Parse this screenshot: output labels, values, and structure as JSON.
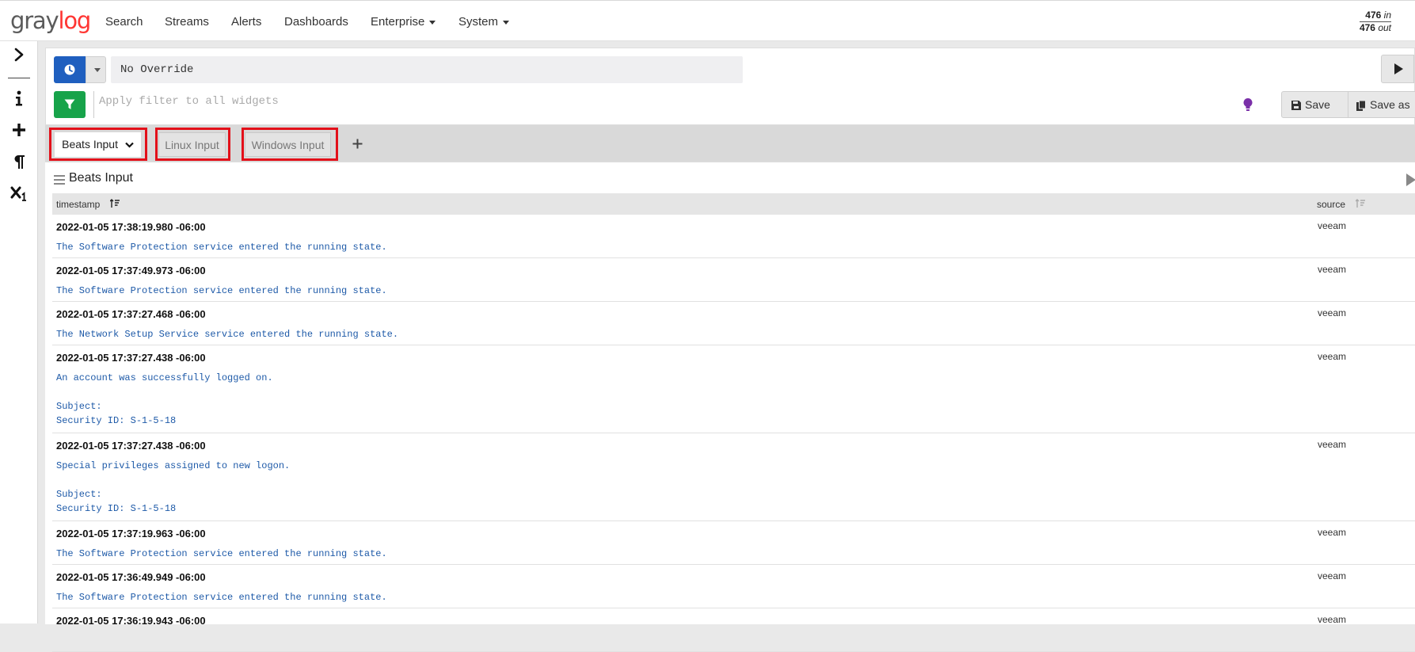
{
  "app": {
    "logo_main": "gray",
    "logo_accent": "log"
  },
  "nav": {
    "items": [
      {
        "label": "Search"
      },
      {
        "label": "Streams"
      },
      {
        "label": "Alerts"
      },
      {
        "label": "Dashboards"
      },
      {
        "label": "Enterprise",
        "dropdown": true
      },
      {
        "label": "System",
        "dropdown": true
      }
    ],
    "throughput": {
      "in_value": "476",
      "in_label": "in",
      "out_value": "476",
      "out_label": "out"
    }
  },
  "sidebar": {
    "icons": [
      "chevron-right-icon",
      "info-icon",
      "plus-icon",
      "paragraph-icon",
      "subscript-icon"
    ]
  },
  "query_bar": {
    "time_override": "No Override",
    "filter_placeholder": "Apply filter to all widgets",
    "save_label": "Save",
    "save_as_label": "Save as"
  },
  "tabs": {
    "items": [
      {
        "label": "Beats Input",
        "active": true
      },
      {
        "label": "Linux Input",
        "active": false
      },
      {
        "label": "Windows Input",
        "active": false
      }
    ],
    "highlight_color": "#e3101a"
  },
  "widget": {
    "title": "Beats Input",
    "columns": {
      "timestamp": "timestamp",
      "source": "source"
    },
    "rows": [
      {
        "timestamp": "2022-01-05 17:38:19.980 -06:00",
        "source": "veeam",
        "message": "The Software Protection service entered the running state."
      },
      {
        "timestamp": "2022-01-05 17:37:49.973 -06:00",
        "source": "veeam",
        "message": "The Software Protection service entered the running state."
      },
      {
        "timestamp": "2022-01-05 17:37:27.468 -06:00",
        "source": "veeam",
        "message": "The Network Setup Service service entered the running state."
      },
      {
        "timestamp": "2022-01-05 17:37:27.438 -06:00",
        "source": "veeam",
        "message": "An account was successfully logged on.\n\nSubject:\nSecurity ID: S-1-5-18"
      },
      {
        "timestamp": "2022-01-05 17:37:27.438 -06:00",
        "source": "veeam",
        "message": "Special privileges assigned to new logon.\n\nSubject:\nSecurity ID: S-1-5-18"
      },
      {
        "timestamp": "2022-01-05 17:37:19.963 -06:00",
        "source": "veeam",
        "message": "The Software Protection service entered the running state."
      },
      {
        "timestamp": "2022-01-05 17:36:49.949 -06:00",
        "source": "veeam",
        "message": "The Software Protection service entered the running state."
      },
      {
        "timestamp": "2022-01-05 17:36:19.943 -06:00",
        "source": "veeam",
        "message": ""
      }
    ]
  },
  "colors": {
    "brand_accent": "#ff3633",
    "primary_blue": "#1f5fbf",
    "filter_green": "#17a34a",
    "message_blue": "#1e5aa8",
    "bulb_purple": "#7a2fa8"
  }
}
